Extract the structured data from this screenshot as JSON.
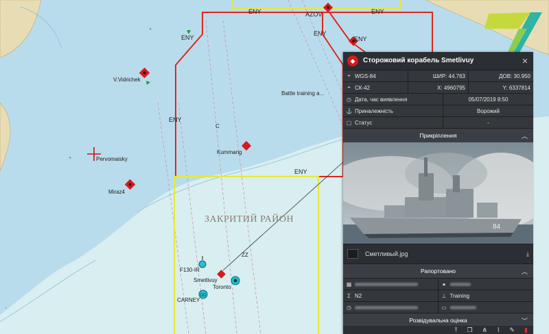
{
  "map": {
    "zone_labels": [
      "ENY",
      "AZOV",
      "ENY",
      "ENY",
      "ENY",
      "ENY",
      "ENY",
      "ENY"
    ],
    "battle_label": "Battle training a...",
    "closed_area_label": "ЗАКРИТИЙ РАЙОН",
    "zz_label": "ZZ",
    "c_label": "C",
    "vessels": [
      {
        "name": "V.Vidrichek"
      },
      {
        "name": "Pervomaisky"
      },
      {
        "name": "Miraz4"
      },
      {
        "name": "Kummang"
      },
      {
        "name": "F130-IR"
      },
      {
        "name": "Smetlivuy"
      },
      {
        "name": "Toronto"
      },
      {
        "name": "CARNEY"
      }
    ],
    "colors": {
      "sea": "#b9dcec",
      "shelf": "#d9eef0",
      "land": "#e8ddb5",
      "hostile": "#d81b1b",
      "friendly": "#20b8c8",
      "zone_red": "#e0261e",
      "zone_yellow": "#e8e83a"
    }
  },
  "panel": {
    "title": "Сторожовий корабель Smetlivuy",
    "close_icon": "close-icon",
    "coords": [
      {
        "sys": "WGS-84",
        "a_label": "ШИР:",
        "a": "44.763",
        "b_label": "ДОВ:",
        "b": "30.950"
      },
      {
        "sys": "СК-42",
        "a_label": "X:",
        "a": "4960795",
        "b_label": "Y:",
        "b": "6337814"
      }
    ],
    "detected_label": "Дата, час виявлення",
    "detected_value": "05/07/2019 8:50",
    "affiliation_label": "Приналежність",
    "affiliation_value": "Ворожий",
    "status_label": "Статус",
    "status_value": "-",
    "attachments_label": "Прикріплення",
    "file_name": "Сметливый.jpg",
    "reported_label": "Рапортовано",
    "reported_unit": "N2",
    "reported_type": "Training",
    "assessment_label": "Розвідувальна оцінка"
  },
  "logo_text": "7"
}
